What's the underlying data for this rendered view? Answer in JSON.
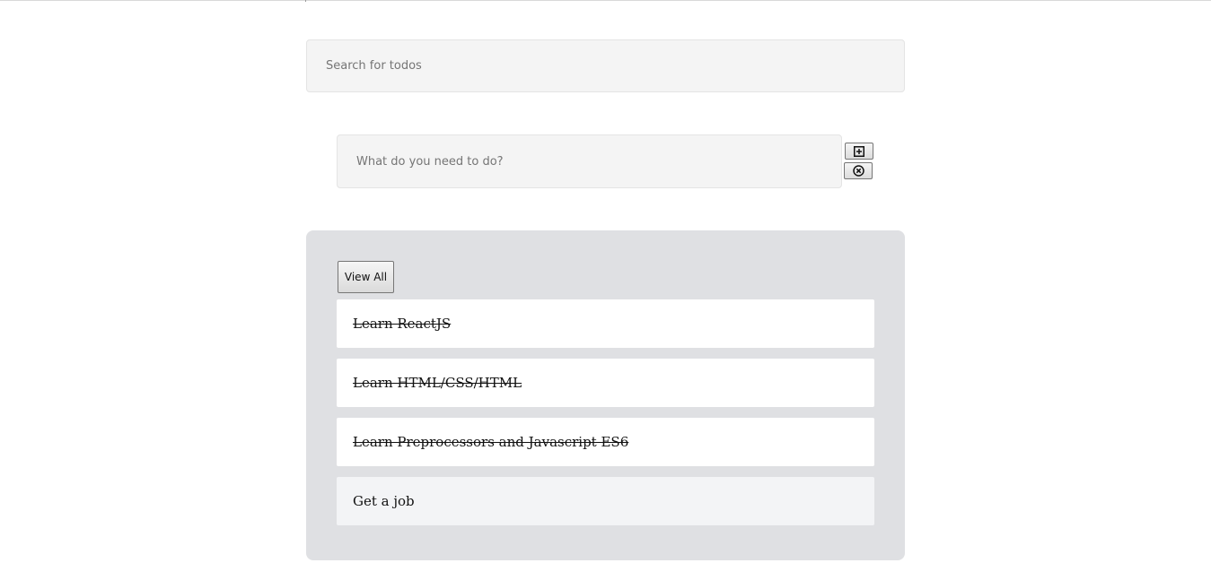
{
  "search": {
    "placeholder": "Search for todos"
  },
  "new_todo": {
    "placeholder": "What do you need to do?",
    "add_icon": "plus-square-icon",
    "clear_icon": "x-circle-icon"
  },
  "filter": {
    "view_all_label": "View All"
  },
  "todos": [
    {
      "text": "Learn ReactJS",
      "completed": true
    },
    {
      "text": "Learn HTML/CSS/HTML",
      "completed": true
    },
    {
      "text": "Learn Preprocessors and Javascript ES6",
      "completed": true
    },
    {
      "text": "Get a job",
      "completed": false
    }
  ],
  "colors": {
    "panel_background": "#dfe0e3",
    "input_background": "#f4f4f4",
    "item_background": "#ffffff",
    "pending_item_background": "#f3f4f6"
  }
}
